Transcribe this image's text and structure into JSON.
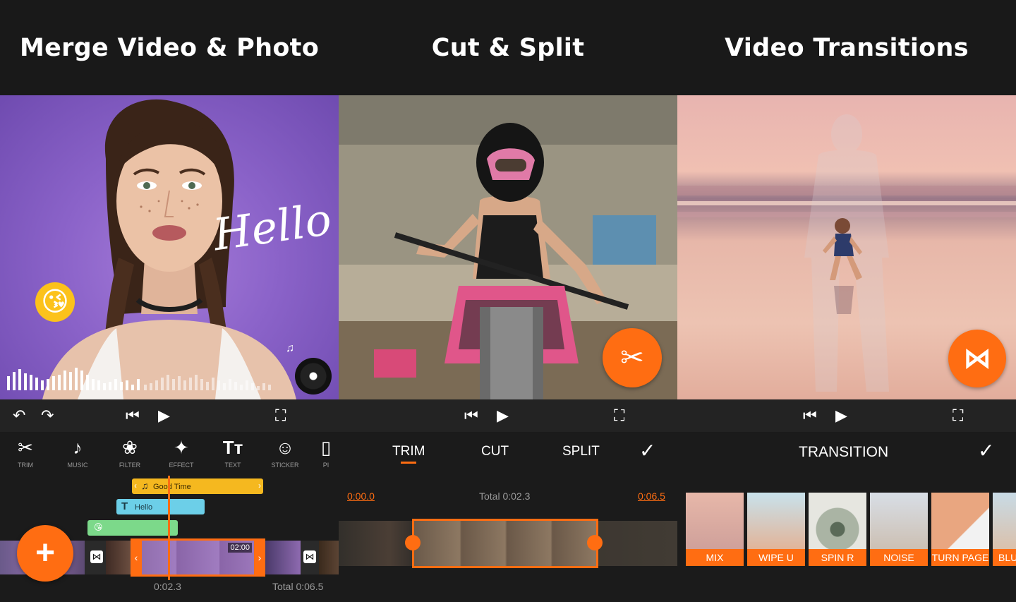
{
  "panels": [
    {
      "title": "Merge Video & Photo",
      "overlay_text": "Hello",
      "toolbar": [
        {
          "label": "TRIM",
          "icon": "scissors-icon"
        },
        {
          "label": "MUSIC",
          "icon": "music-note-icon"
        },
        {
          "label": "FILTER",
          "icon": "filter-icon"
        },
        {
          "label": "EFFECT",
          "icon": "magic-wand-icon"
        },
        {
          "label": "TEXT",
          "icon": "text-icon"
        },
        {
          "label": "STICKER",
          "icon": "sticker-icon"
        },
        {
          "label": "PI",
          "icon": "pip-icon"
        }
      ],
      "music_track": "Good Time",
      "text_track": "Hello",
      "clip_duration": "02:00",
      "current_time": "0:02.3",
      "total_time": "Total 0:06.5"
    },
    {
      "title": "Cut & Split",
      "tabs": [
        "TRIM",
        "CUT",
        "SPLIT"
      ],
      "active_tab": "TRIM",
      "start_time": "0:00.0",
      "total": "Total 0:02.3",
      "end_time": "0:06.5"
    },
    {
      "title": "Video Transitions",
      "section_title": "TRANSITION",
      "transitions": [
        "MIX",
        "WIPE U",
        "SPIN R",
        "NOISE",
        "TURN PAGE",
        "BLU"
      ]
    }
  ],
  "colors": {
    "accent": "#ff6d12",
    "background": "#1a1a1a",
    "music_track": "#f5b81f",
    "text_track": "#6ccfe8",
    "sticker_track": "#7cd98a"
  }
}
